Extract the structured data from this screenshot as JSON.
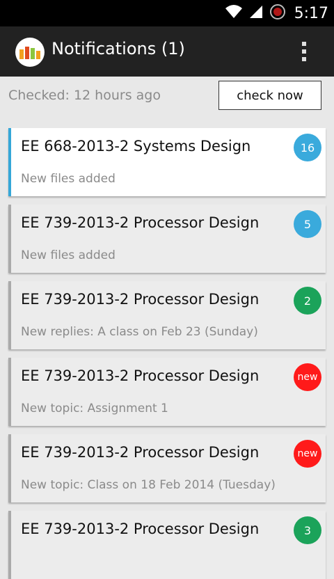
{
  "status_bar": {
    "time": "5:17",
    "icons": [
      "wifi-icon",
      "signal-icon",
      "notification-circle-icon"
    ]
  },
  "action_bar": {
    "logo_icon": "app-logo-icon",
    "title": "Notifications (1)",
    "menu_icon": "overflow-menu-icon"
  },
  "header": {
    "checked_text": "Checked: 12 hours ago",
    "check_button": "check now"
  },
  "colors": {
    "accent_blue": "#35a7d8",
    "badge_green": "#1ba35a",
    "badge_red": "#ff1a1a"
  },
  "notifications": [
    {
      "title": "EE 668-2013-2 Systems Design",
      "subtitle": "New files added",
      "badge": "16",
      "badge_color": "#3aaadc",
      "active": true
    },
    {
      "title": "EE 739-2013-2 Processor Design",
      "subtitle": "New files added",
      "badge": "5",
      "badge_color": "#3aaadc",
      "active": false
    },
    {
      "title": "EE 739-2013-2 Processor Design",
      "subtitle": "New replies: A class on Feb 23 (Sunday)",
      "badge": "2",
      "badge_color": "#1ba35a",
      "active": false
    },
    {
      "title": "EE 739-2013-2 Processor Design",
      "subtitle": "New topic: Assignment 1",
      "badge": "new",
      "badge_color": "#ff1a1a",
      "active": false
    },
    {
      "title": "EE 739-2013-2 Processor Design",
      "subtitle": "New topic: Class on 18 Feb 2014 (Tuesday)",
      "badge": "new",
      "badge_color": "#ff1a1a",
      "active": false
    },
    {
      "title": "EE 739-2013-2 Processor Design",
      "subtitle": "",
      "badge": "3",
      "badge_color": "#1ba35a",
      "active": false
    }
  ]
}
